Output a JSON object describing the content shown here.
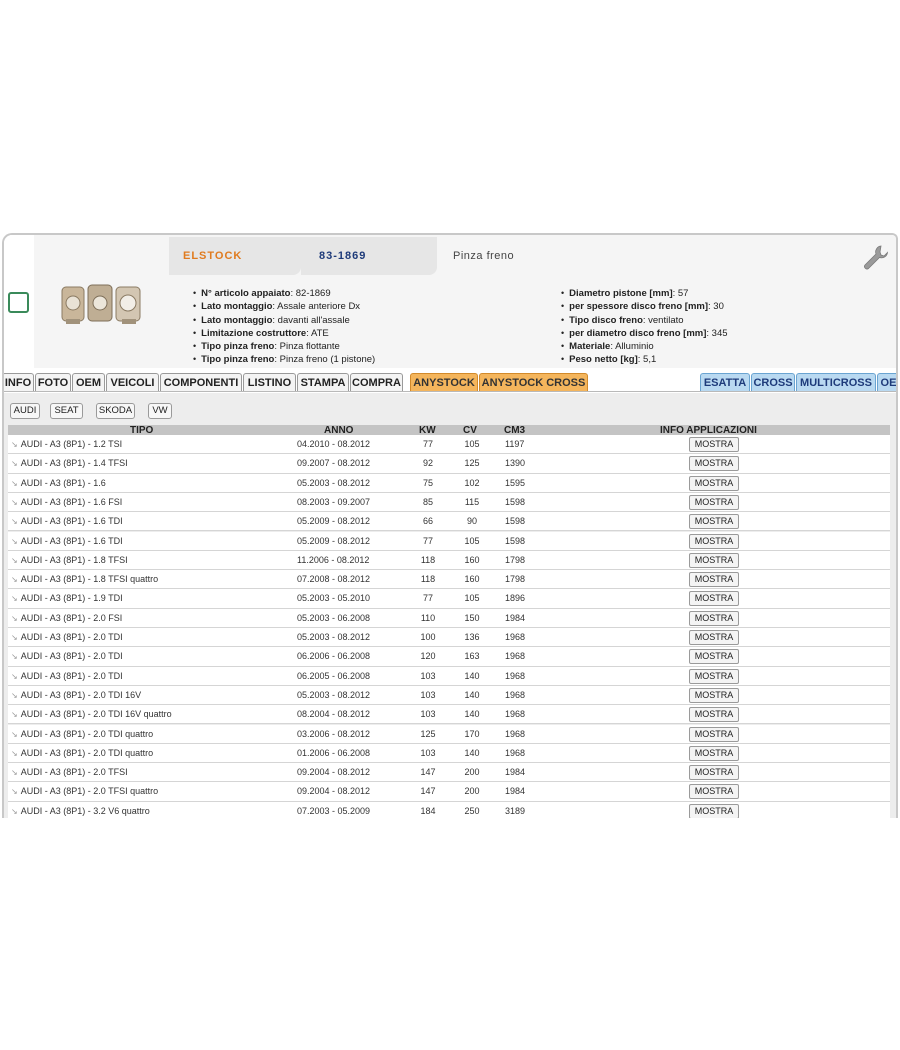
{
  "header": {
    "brand": "ELSTOCK",
    "article_code": "83-1869",
    "description": "Pinza freno"
  },
  "specs_left": [
    {
      "label": "N° articolo appaiato",
      "value": ": 82-1869"
    },
    {
      "label": "Lato montaggio",
      "value": ": Assale anteriore Dx"
    },
    {
      "label": "Lato montaggio",
      "value": ": davanti all'assale"
    },
    {
      "label": "Limitazione costruttore",
      "value": ": ATE"
    },
    {
      "label": "Tipo pinza freno",
      "value": ": Pinza flottante"
    },
    {
      "label": "Tipo pinza freno",
      "value": ": Pinza freno (1 pistone)"
    }
  ],
  "specs_right": [
    {
      "label": "Diametro pistone [mm]",
      "value": ": 57"
    },
    {
      "label": "per spessore disco freno [mm]",
      "value": ": 30"
    },
    {
      "label": "Tipo disco freno",
      "value": ": ventilato"
    },
    {
      "label": "per diametro disco freno [mm]",
      "value": ": 345"
    },
    {
      "label": "Materiale",
      "value": ": Alluminio"
    },
    {
      "label": "Peso netto [kg]",
      "value": ": 5,1"
    }
  ],
  "tabs": [
    "INFO",
    "FOTO",
    "OEM",
    "VEICOLI",
    "COMPONENTI",
    "LISTINO",
    "STAMPA",
    "COMPRA",
    "ANYSTOCK",
    "ANYSTOCK CROSS",
    "ESATTA",
    "CROSS",
    "MULTICROSS",
    "OE"
  ],
  "manufacturers": [
    "AUDI",
    "SEAT",
    "SKODA",
    "VW"
  ],
  "table": {
    "headers": {
      "tipo": "TIPO",
      "anno": "ANNO",
      "kw": "KW",
      "cv": "CV",
      "cm3": "CM3",
      "info": "INFO APPLICAZIONI"
    },
    "button_label": "MOSTRA",
    "rows": [
      {
        "tipo": "AUDI - A3 (8P1) - 1.2 TSI",
        "anno": "04.2010 - 08.2012",
        "kw": "77",
        "cv": "105",
        "cm3": "1197"
      },
      {
        "tipo": "AUDI - A3 (8P1) - 1.4 TFSI",
        "anno": "09.2007 - 08.2012",
        "kw": "92",
        "cv": "125",
        "cm3": "1390"
      },
      {
        "tipo": "AUDI - A3 (8P1) - 1.6",
        "anno": "05.2003 - 08.2012",
        "kw": "75",
        "cv": "102",
        "cm3": "1595"
      },
      {
        "tipo": "AUDI - A3 (8P1) - 1.6 FSI",
        "anno": "08.2003 - 09.2007",
        "kw": "85",
        "cv": "115",
        "cm3": "1598"
      },
      {
        "tipo": "AUDI - A3 (8P1) - 1.6 TDI",
        "anno": "05.2009 - 08.2012",
        "kw": "66",
        "cv": "90",
        "cm3": "1598"
      },
      {
        "tipo": "AUDI - A3 (8P1) - 1.6 TDI",
        "anno": "05.2009 - 08.2012",
        "kw": "77",
        "cv": "105",
        "cm3": "1598"
      },
      {
        "tipo": "AUDI - A3 (8P1) - 1.8 TFSI",
        "anno": "11.2006 - 08.2012",
        "kw": "118",
        "cv": "160",
        "cm3": "1798"
      },
      {
        "tipo": "AUDI - A3 (8P1) - 1.8 TFSI quattro",
        "anno": "07.2008 - 08.2012",
        "kw": "118",
        "cv": "160",
        "cm3": "1798"
      },
      {
        "tipo": "AUDI - A3 (8P1) - 1.9 TDI",
        "anno": "05.2003 - 05.2010",
        "kw": "77",
        "cv": "105",
        "cm3": "1896"
      },
      {
        "tipo": "AUDI - A3 (8P1) - 2.0 FSI",
        "anno": "05.2003 - 06.2008",
        "kw": "110",
        "cv": "150",
        "cm3": "1984"
      },
      {
        "tipo": "AUDI - A3 (8P1) - 2.0 TDI",
        "anno": "05.2003 - 08.2012",
        "kw": "100",
        "cv": "136",
        "cm3": "1968"
      },
      {
        "tipo": "AUDI - A3 (8P1) - 2.0 TDI",
        "anno": "06.2006 - 06.2008",
        "kw": "120",
        "cv": "163",
        "cm3": "1968"
      },
      {
        "tipo": "AUDI - A3 (8P1) - 2.0 TDI",
        "anno": "06.2005 - 06.2008",
        "kw": "103",
        "cv": "140",
        "cm3": "1968"
      },
      {
        "tipo": "AUDI - A3 (8P1) - 2.0 TDI 16V",
        "anno": "05.2003 - 08.2012",
        "kw": "103",
        "cv": "140",
        "cm3": "1968"
      },
      {
        "tipo": "AUDI - A3 (8P1) - 2.0 TDI 16V quattro",
        "anno": "08.2004 - 08.2012",
        "kw": "103",
        "cv": "140",
        "cm3": "1968"
      },
      {
        "tipo": "AUDI - A3 (8P1) - 2.0 TDI quattro",
        "anno": "03.2006 - 08.2012",
        "kw": "125",
        "cv": "170",
        "cm3": "1968"
      },
      {
        "tipo": "AUDI - A3 (8P1) - 2.0 TDI quattro",
        "anno": "01.2006 - 06.2008",
        "kw": "103",
        "cv": "140",
        "cm3": "1968"
      },
      {
        "tipo": "AUDI - A3 (8P1) - 2.0 TFSI",
        "anno": "09.2004 - 08.2012",
        "kw": "147",
        "cv": "200",
        "cm3": "1984"
      },
      {
        "tipo": "AUDI - A3 (8P1) - 2.0 TFSI quattro",
        "anno": "09.2004 - 08.2012",
        "kw": "147",
        "cv": "200",
        "cm3": "1984"
      },
      {
        "tipo": "AUDI - A3 (8P1) - 3.2 V6 quattro",
        "anno": "07.2003 - 05.2009",
        "kw": "184",
        "cv": "250",
        "cm3": "3189"
      }
    ]
  },
  "colors": {
    "brand": "#e07b1f",
    "code": "#1e3b7a",
    "tab_orange": "#f4b55c",
    "tab_blue": "#b9d9f1",
    "checkbox": "#3a8a5a"
  },
  "icons": {
    "settings": "wrench-icon",
    "product": "brake-caliper-image"
  }
}
